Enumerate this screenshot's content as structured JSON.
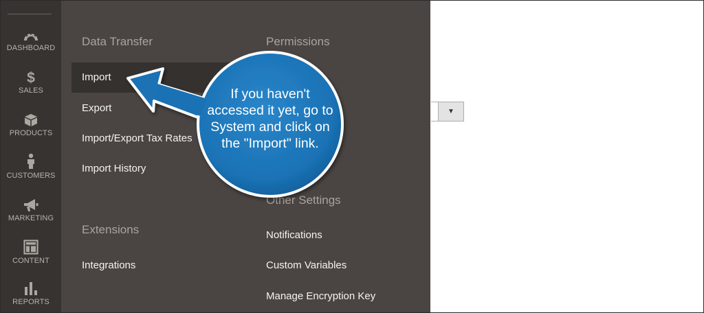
{
  "sidebar": {
    "items": [
      {
        "label": "DASHBOARD",
        "icon": "speedometer-icon"
      },
      {
        "label": "SALES",
        "icon": "dollar-icon"
      },
      {
        "label": "PRODUCTS",
        "icon": "box-icon"
      },
      {
        "label": "CUSTOMERS",
        "icon": "person-icon"
      },
      {
        "label": "MARKETING",
        "icon": "megaphone-icon"
      },
      {
        "label": "CONTENT",
        "icon": "layout-icon"
      },
      {
        "label": "REPORTS",
        "icon": "bar-chart-icon"
      }
    ]
  },
  "menu": {
    "data_transfer": {
      "title": "Data Transfer",
      "links": [
        "Import",
        "Export",
        "Import/Export Tax Rates",
        "Import History"
      ]
    },
    "extensions": {
      "title": "Extensions",
      "links": [
        "Integrations"
      ]
    },
    "permissions": {
      "title": "Permissions"
    },
    "other_settings": {
      "title": "Other Settings",
      "links": [
        "Notifications",
        "Custom Variables",
        "Manage Encryption Key"
      ]
    }
  },
  "select": {
    "arrow": "▼"
  },
  "callout": {
    "lines": [
      "If you haven't",
      "accessed it yet, go to",
      "System and click on",
      "the \"Import\" link."
    ],
    "color": "#1a72b5"
  },
  "colors": {
    "sidebar": "#373330",
    "flyout": "#4a4542",
    "active_item": "#35312e"
  }
}
